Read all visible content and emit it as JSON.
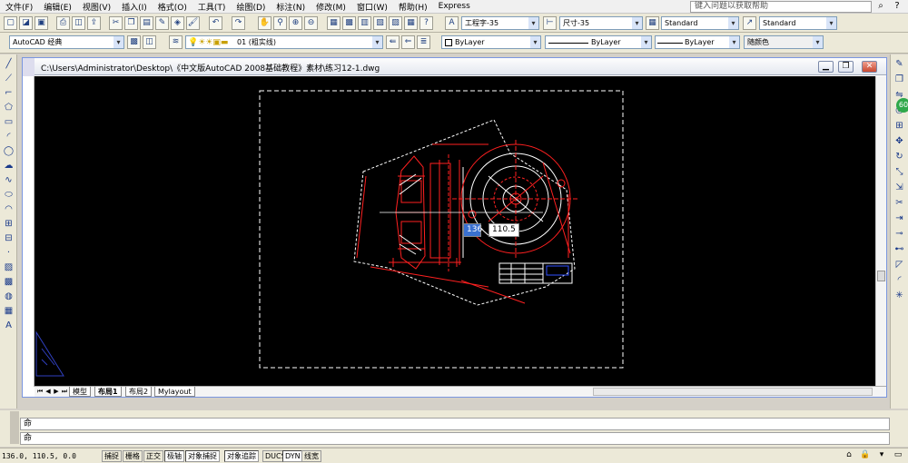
{
  "menu": [
    "文件(F)",
    "编辑(E)",
    "视图(V)",
    "插入(I)",
    "格式(O)",
    "工具(T)",
    "绘图(D)",
    "标注(N)",
    "修改(M)",
    "窗口(W)",
    "帮助(H)",
    "Express"
  ],
  "help": {
    "placeholder": "键入问题以获取帮助"
  },
  "styles": {
    "text_style": "工程字-35",
    "dim_style": "尺寸-35",
    "table_style": "Standard",
    "multileader_style": "Standard"
  },
  "workspace": "AutoCAD 经典",
  "layer": "01 (粗实线)",
  "properties": {
    "color": "ByLayer",
    "linetype": "ByLayer",
    "lineweight": "ByLayer",
    "plotstyle": "随颜色"
  },
  "drawing": {
    "title": "C:\\Users\\Administrator\\Desktop\\《中文版AutoCAD 2008基础教程》素材\\练习12-1.dwg",
    "dynamic_x": "136",
    "dynamic_y": "110.5"
  },
  "layout_tabs": [
    "模型",
    "布局1",
    "布局2",
    "Mylayout"
  ],
  "active_tab": "布局1",
  "command": {
    "line1": "命",
    "line2": "命"
  },
  "status": {
    "coords": "136.0, 110.5, 0.0",
    "buttons": [
      "捕捉",
      "栅格",
      "正交",
      "极轴",
      "对象捕捉",
      "对象追踪",
      "DUCS",
      "DYN",
      "线宽"
    ]
  },
  "left_tools": [
    "line-icon",
    "construction-line-icon",
    "polyline-icon",
    "polygon-icon",
    "rectangle-icon",
    "arc-icon",
    "circle-icon",
    "revcloud-icon",
    "spline-icon",
    "ellipse-icon",
    "ellipse-arc-icon",
    "insert-block-icon",
    "make-block-icon",
    "point-icon",
    "hatch-icon",
    "gradient-icon",
    "region-icon",
    "table-icon",
    "mtext-icon"
  ],
  "right_tools": [
    "erase-icon",
    "copy-icon",
    "mirror-icon",
    "offset-icon",
    "array-icon",
    "move-icon",
    "rotate-icon",
    "scale-icon",
    "stretch-icon",
    "trim-icon",
    "extend-icon",
    "break-icon",
    "join-icon",
    "chamfer-icon",
    "fillet-icon",
    "explode-icon"
  ],
  "colors": {
    "canvas": "#000000",
    "geometry_red": "#ff2020",
    "geometry_white": "#ffffff"
  }
}
